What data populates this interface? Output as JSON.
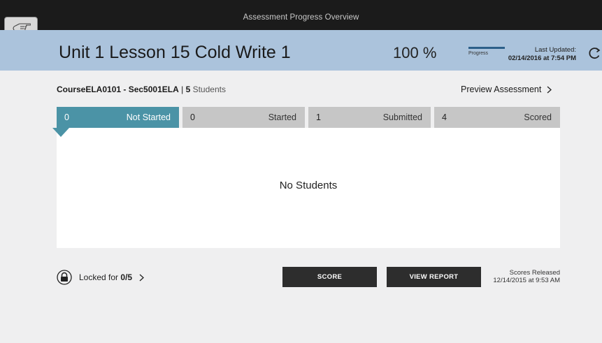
{
  "topbar": {
    "title": "Assessment Progress Overview"
  },
  "header": {
    "lesson_title": "Unit 1 Lesson 15 Cold Write 1",
    "percent": "100 %",
    "progress_label": "Progress",
    "progress_fraction": 1.0,
    "updated_label": "Last Updated:",
    "updated_time": "02/14/2016 at 7:54 PM"
  },
  "course": {
    "name": "CourseELA0101 - Sec5001ELA",
    "separator": "|",
    "count": "5",
    "count_label": "Students"
  },
  "preview_label": "Preview Assessment",
  "tabs": [
    {
      "count": "0",
      "label": "Not Started"
    },
    {
      "count": "0",
      "label": "Started"
    },
    {
      "count": "1",
      "label": "Submitted"
    },
    {
      "count": "4",
      "label": "Scored"
    }
  ],
  "empty_message": "No Students",
  "lock": {
    "prefix": "Locked for",
    "value": "0/5"
  },
  "buttons": {
    "score": "SCORE",
    "view_report": "VIEW REPORT"
  },
  "released": {
    "label": "Scores Released",
    "time": "12/14/2015 at 9:53 AM"
  },
  "colors": {
    "header_bg": "#abc3dc",
    "active_tab": "#4b93a6",
    "tab_bg": "#c6c6c6",
    "topbar": "#1b1b1b"
  }
}
